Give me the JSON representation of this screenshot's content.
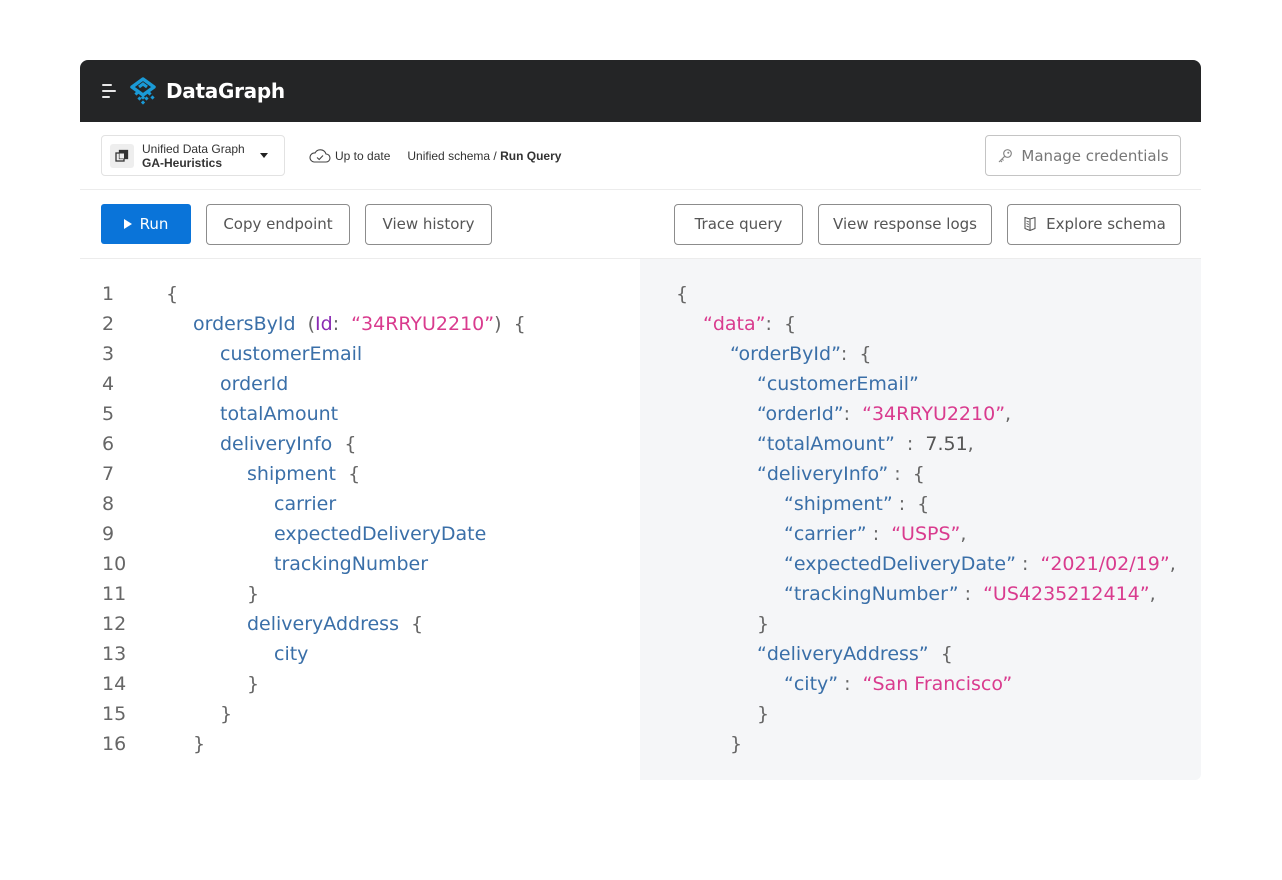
{
  "header": {
    "brand": "DataGraph",
    "menu_icon": "hamburger-menu-icon",
    "logo_icon": "datagraph-logo-icon"
  },
  "subbar": {
    "graph_selector": {
      "label": "Unified Data Graph",
      "value": "GA-Heuristics",
      "icon": "graph-copy-icon"
    },
    "status": {
      "icon": "cloud-check-icon",
      "text": "Up to date"
    },
    "breadcrumb": {
      "parent": "Unified schema / ",
      "current": "Run Query"
    },
    "manage_credentials": {
      "label": "Manage credentials",
      "icon": "key-icon"
    }
  },
  "toolbar": {
    "run": "Run",
    "copy_endpoint": "Copy endpoint",
    "view_history": "View history",
    "trace_query": "Trace query",
    "view_response_logs": "View response logs",
    "explore_schema": "Explore schema"
  },
  "colors": {
    "accent": "#0a74d9",
    "header_bg": "#242526",
    "keyword": "#3a6fa8",
    "string": "#d93b8e",
    "argument": "#8a2bb3",
    "response_bg": "#f5f6f8"
  },
  "query": {
    "lines": [
      {
        "n": "1",
        "indent": 0,
        "parts": [
          [
            "br",
            "{"
          ]
        ]
      },
      {
        "n": "2",
        "indent": 1,
        "parts": [
          [
            "kw",
            "ordersById"
          ],
          [
            "br",
            "  ("
          ],
          [
            "arg",
            "Id"
          ],
          [
            "br",
            ":  "
          ],
          [
            "str",
            "“34RRYU2210”"
          ],
          [
            "br",
            ")  {"
          ]
        ]
      },
      {
        "n": "3",
        "indent": 2,
        "parts": [
          [
            "kw",
            "customerEmail"
          ]
        ]
      },
      {
        "n": "4",
        "indent": 2,
        "parts": [
          [
            "kw",
            "orderId"
          ]
        ]
      },
      {
        "n": "5",
        "indent": 2,
        "parts": [
          [
            "kw",
            "totalAmount"
          ]
        ]
      },
      {
        "n": "6",
        "indent": 2,
        "parts": [
          [
            "kw",
            "deliveryInfo"
          ],
          [
            "br",
            "  {"
          ]
        ]
      },
      {
        "n": "7",
        "indent": 3,
        "parts": [
          [
            "kw",
            "shipment"
          ],
          [
            "br",
            "  {"
          ]
        ]
      },
      {
        "n": "8",
        "indent": 4,
        "parts": [
          [
            "kw",
            "carrier"
          ]
        ]
      },
      {
        "n": "9",
        "indent": 4,
        "parts": [
          [
            "kw",
            "expectedDeliveryDate"
          ]
        ]
      },
      {
        "n": "10",
        "indent": 4,
        "parts": [
          [
            "kw",
            "trackingNumber"
          ]
        ]
      },
      {
        "n": "11",
        "indent": 3,
        "parts": [
          [
            "br",
            "}"
          ]
        ]
      },
      {
        "n": "12",
        "indent": 3,
        "parts": [
          [
            "kw",
            "deliveryAddress"
          ],
          [
            "br",
            "  {"
          ]
        ]
      },
      {
        "n": "13",
        "indent": 4,
        "parts": [
          [
            "kw",
            "city"
          ]
        ]
      },
      {
        "n": "14",
        "indent": 3,
        "parts": [
          [
            "br",
            "}"
          ]
        ]
      },
      {
        "n": "15",
        "indent": 2,
        "parts": [
          [
            "br",
            "}"
          ]
        ]
      },
      {
        "n": "16",
        "indent": 1,
        "parts": [
          [
            "br",
            "}"
          ]
        ]
      }
    ]
  },
  "response": {
    "lines": [
      {
        "indent": 0,
        "parts": [
          [
            "br",
            "{"
          ]
        ]
      },
      {
        "indent": 1,
        "parts": [
          [
            "str",
            "“data”"
          ],
          [
            "br",
            ":  {"
          ]
        ]
      },
      {
        "indent": 2,
        "parts": [
          [
            "kw",
            "“orderById”"
          ],
          [
            "br",
            ":  {"
          ]
        ]
      },
      {
        "indent": 3,
        "parts": [
          [
            "kw",
            "“customerEmail”"
          ]
        ]
      },
      {
        "indent": 3,
        "parts": [
          [
            "kw",
            "“orderId”"
          ],
          [
            "br",
            ":  "
          ],
          [
            "str",
            "“34RRYU2210”"
          ],
          [
            "br",
            ","
          ]
        ]
      },
      {
        "indent": 3,
        "parts": [
          [
            "kw",
            "“totalAmount”"
          ],
          [
            "br",
            "  :  "
          ],
          [
            "num",
            "7.51"
          ],
          [
            "br",
            ","
          ]
        ]
      },
      {
        "indent": 3,
        "parts": [
          [
            "kw",
            "“deliveryInfo”"
          ],
          [
            "br",
            " :  {"
          ]
        ]
      },
      {
        "indent": 4,
        "parts": [
          [
            "kw",
            "“shipment”"
          ],
          [
            "br",
            " :  {"
          ]
        ]
      },
      {
        "indent": 4,
        "parts": [
          [
            "kw",
            "“carrier”"
          ],
          [
            "br",
            " :  "
          ],
          [
            "str",
            "“USPS”"
          ],
          [
            "br",
            ","
          ]
        ]
      },
      {
        "indent": 4,
        "parts": [
          [
            "kw",
            "“expectedDeliveryDate”"
          ],
          [
            "br",
            " :  "
          ],
          [
            "str",
            "“2021/02/19”"
          ],
          [
            "br",
            ","
          ]
        ]
      },
      {
        "indent": 4,
        "parts": [
          [
            "kw",
            "“trackingNumber”"
          ],
          [
            "br",
            " :  "
          ],
          [
            "str",
            "“US4235212414”"
          ],
          [
            "br",
            ","
          ]
        ]
      },
      {
        "indent": 3,
        "parts": [
          [
            "br",
            "}"
          ]
        ]
      },
      {
        "indent": 3,
        "parts": [
          [
            "kw",
            "“deliveryAddress”"
          ],
          [
            "br",
            "  {"
          ]
        ]
      },
      {
        "indent": 4,
        "parts": [
          [
            "kw",
            "“city”"
          ],
          [
            "br",
            " :  "
          ],
          [
            "str",
            "“San Francisco”"
          ]
        ]
      },
      {
        "indent": 3,
        "parts": [
          [
            "br",
            "}"
          ]
        ]
      },
      {
        "indent": 2,
        "parts": [
          [
            "br",
            "}"
          ]
        ]
      }
    ]
  }
}
